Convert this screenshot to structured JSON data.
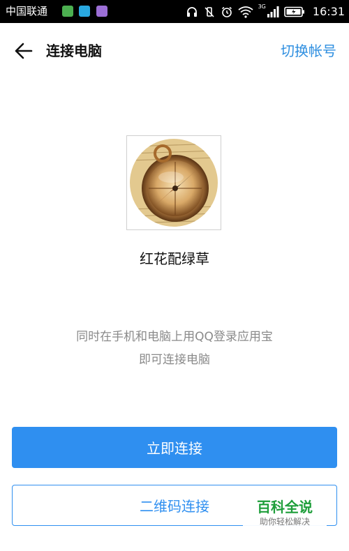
{
  "status_bar": {
    "carrier": "中国联通",
    "network_type": "3G",
    "time": "16:31",
    "icons": [
      "headset-icon",
      "vibrate-icon",
      "alarm-icon",
      "wifi-icon",
      "signal-icon",
      "battery-icon"
    ]
  },
  "header": {
    "title": "连接电脑",
    "switch_account_label": "切换帐号"
  },
  "profile": {
    "nickname": "红花配绿草"
  },
  "hint": {
    "line1": "同时在手机和电脑上用QQ登录应用宝",
    "line2": "即可连接电脑"
  },
  "actions": {
    "connect_now_label": "立即连接",
    "qr_connect_label": "二维码连接"
  },
  "watermark": {
    "main": "百科全说",
    "sub": "助你轻松解决"
  },
  "colors": {
    "accent": "#2f8ff0",
    "watermark_green": "#1e9e3a"
  }
}
